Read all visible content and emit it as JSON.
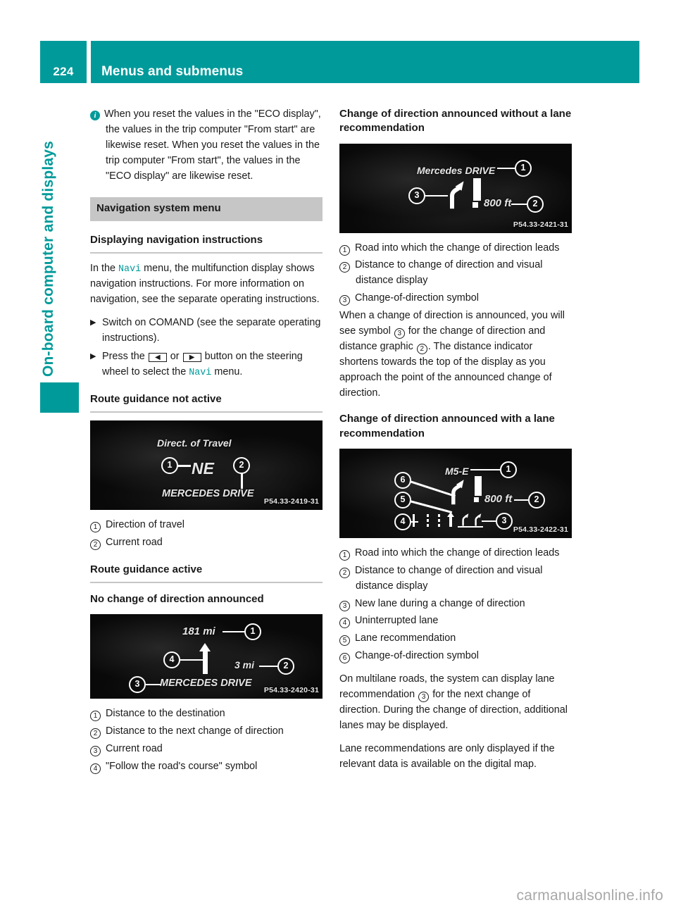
{
  "header": {
    "page_number": "224",
    "title": "Menus and submenus"
  },
  "chapter_tab": {
    "label": "On-board computer and displays"
  },
  "left_column": {
    "note": "When you reset the values in the \"ECO display\", the values in the trip computer \"From start\" are likewise reset. When you reset the values in the trip computer \"From start\", the values in the \"ECO display\" are likewise reset.",
    "section_bar": "Navigation system menu",
    "heading_displaying": "Displaying navigation instructions",
    "intro_pre": "In the",
    "intro_code": "Navi",
    "intro_post": "menu, the multifunction display shows navigation instructions. For more information on navigation, see the separate operating instructions.",
    "step1": "Switch on COMAND (see the separate operating instructions).",
    "step2_pre": "Press the",
    "step2_key_left": "◀",
    "step2_or": "or",
    "step2_key_right": "▶",
    "step2_mid": "button on the steering wheel to select the",
    "step2_code": "Navi",
    "step2_post": "menu.",
    "heading_rg_not_active": "Route guidance not active",
    "figure_1": {
      "code": "P54.33-2419-31",
      "title_text": "Direct. of Travel",
      "value_text": "NE",
      "road_text": "MERCEDES DRIVE",
      "callouts": [
        "1",
        "2"
      ]
    },
    "legend_1": [
      {
        "num": "1",
        "text": "Direction of travel"
      },
      {
        "num": "2",
        "text": "Current road"
      }
    ],
    "heading_rg_active": "Route guidance active",
    "heading_no_change": "No change of direction announced",
    "figure_2": {
      "code": "P54.33-2420-31",
      "dist_dest": "181 mi",
      "dist_next": "3 mi",
      "road_text": "MERCEDES DRIVE",
      "callouts": [
        "1",
        "2",
        "3",
        "4"
      ]
    },
    "legend_2": [
      {
        "num": "1",
        "text": "Distance to the destination"
      },
      {
        "num": "2",
        "text": "Distance to the next change of direction"
      },
      {
        "num": "3",
        "text": "Current road"
      },
      {
        "num": "4",
        "text": "\"Follow the road's course\" symbol"
      }
    ]
  },
  "right_column": {
    "heading_without_lane": "Change of direction announced without a lane recommendation",
    "figure_3": {
      "code": "P54.33-2421-31",
      "road_text": "Mercedes DRIVE",
      "distance_text": "800 ft",
      "callouts": [
        "1",
        "2",
        "3"
      ]
    },
    "legend_3": [
      {
        "num": "1",
        "text": "Road into which the change of direction leads"
      },
      {
        "num": "2",
        "text": "Distance to change of direction and visual distance display"
      },
      {
        "num": "3",
        "text": "Change-of-direction symbol"
      }
    ],
    "para_1_a": "When a change of direction is announced, you will see symbol",
    "para_1_ref1": "3",
    "para_1_b": "for the change of direction and distance graphic",
    "para_1_ref2": "2",
    "para_1_c": ". The distance indicator shortens towards the top of the display as you approach the point of the announced change of direction.",
    "heading_with_lane": "Change of direction announced with a lane recommendation",
    "figure_4": {
      "code": "P54.33-2422-31",
      "road_text": "M5-E",
      "distance_text": "800 ft",
      "callouts": [
        "1",
        "2",
        "3",
        "4",
        "5",
        "6"
      ]
    },
    "legend_4": [
      {
        "num": "1",
        "text": "Road into which the change of direction leads"
      },
      {
        "num": "2",
        "text": "Distance to change of direction and visual distance display"
      },
      {
        "num": "3",
        "text": "New lane during a change of direction"
      },
      {
        "num": "4",
        "text": "Uninterrupted lane"
      },
      {
        "num": "5",
        "text": "Lane recommendation"
      },
      {
        "num": "6",
        "text": "Change-of-direction symbol"
      }
    ],
    "para_2_a": "On multilane roads, the system can display lane recommendation",
    "para_2_ref": "3",
    "para_2_b": "for the next change of direction. During the change of direction, additional lanes may be displayed.",
    "para_3": "Lane recommendations are only displayed if the relevant data is available on the digital map."
  },
  "footer": {
    "watermark": "carmanualsonline.info"
  },
  "colors": {
    "brand_teal": "#009a9a",
    "section_grey": "#c6c6c6",
    "text": "#1a1a1a",
    "watermark_grey": "#a8a8a8"
  }
}
